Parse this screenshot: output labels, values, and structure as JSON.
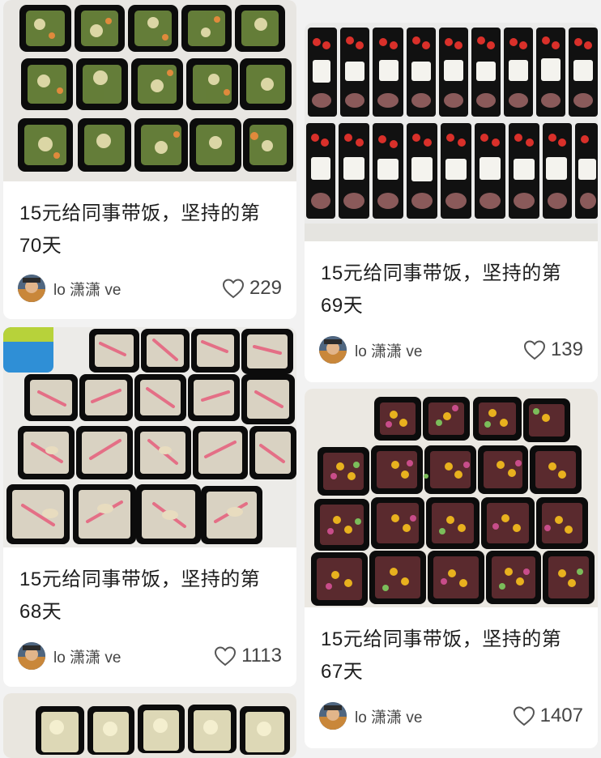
{
  "cards": [
    {
      "title": "15元给同事带饭，坚持的第70天",
      "author": "lo 潇潇 ve",
      "likes": "229"
    },
    {
      "title": "15元给同事带饭，坚持的第69天",
      "author": "lo 潇潇 ve",
      "likes": "139"
    },
    {
      "title": "15元给同事带饭，坚持的第68天",
      "author": "lo 潇潇 ve",
      "likes": "1113"
    },
    {
      "title": "15元给同事带饭，坚持的第67天",
      "author": "lo 潇潇 ve",
      "likes": "1407"
    }
  ],
  "icons": {
    "like": "heart-outline-icon"
  },
  "colors": {
    "background": "#f2f2f2",
    "card": "#ffffff",
    "text": "#1e1e1e"
  }
}
